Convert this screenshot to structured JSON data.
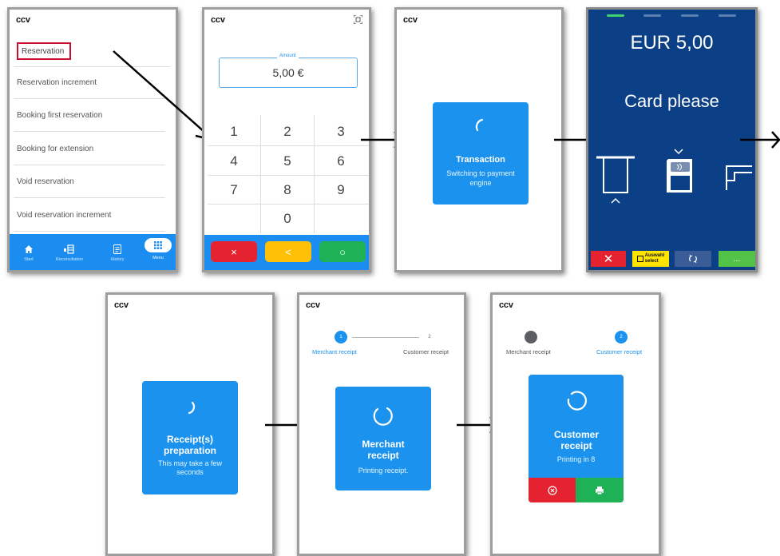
{
  "brand": "ccv",
  "screen1": {
    "menu_items": [
      "Reservation",
      "Reservation increment",
      "Booking first reservation",
      "Booking for extension",
      "Void reservation",
      "Void reservation increment"
    ],
    "nav": [
      "Start",
      "Reconciliation",
      "History",
      "Menu"
    ]
  },
  "screen2": {
    "amount_label": "Amount",
    "amount_value": "5,00 €",
    "keys": [
      "1",
      "2",
      "3",
      "4",
      "5",
      "6",
      "7",
      "8",
      "9",
      "0"
    ],
    "cancel": "×",
    "back": "<",
    "ok": "○"
  },
  "screen3": {
    "title": "Transaction",
    "subtitle": "Switching to payment engine"
  },
  "screen4": {
    "amount": "EUR 5,00",
    "prompt": "Card please",
    "select_label_1": "Auswahl",
    "select_label_2": "select",
    "stop": "✕",
    "more": "..."
  },
  "screen5": {
    "title": "Receipt(s) preparation",
    "subtitle": "This may take a few seconds"
  },
  "screen6": {
    "step1": "1",
    "step2": "2",
    "label1": "Merchant receipt",
    "label2": "Customer receipt",
    "title": "Merchant receipt",
    "subtitle": "Printing receipt."
  },
  "screen7": {
    "step2": "2",
    "label1": "Merchant receipt",
    "label2": "Customer receipt",
    "title": "Customer receipt",
    "subtitle": "Printing in 8"
  },
  "colors": {
    "blue": "#1b93ee",
    "navy": "#0b3f86",
    "red": "#e52330",
    "yellow": "#ffc107",
    "green": "#1eb155"
  }
}
